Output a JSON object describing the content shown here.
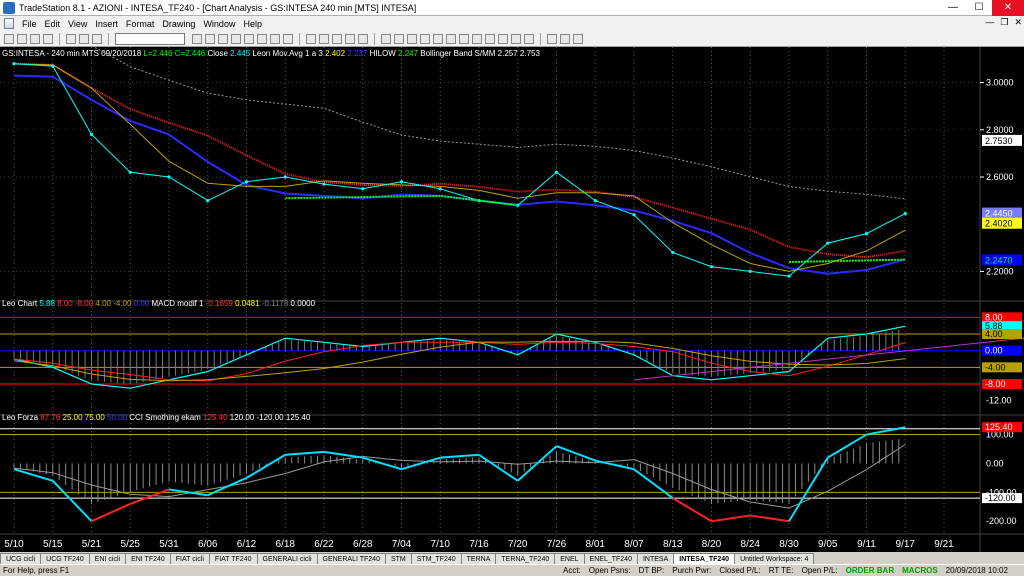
{
  "window": {
    "title": "TradeStation 8.1 - AZIONI - INTESA_TF240 - [Chart Analysis - GS:INTESA  240 min  [MTS] INTESA]"
  },
  "menu": [
    "File",
    "Edit",
    "View",
    "Insert",
    "Format",
    "Drawing",
    "Window",
    "Help"
  ],
  "chart": {
    "price_header": [
      {
        "text": "GS:INTESA - 240 min   MTS  09/20/2018  ",
        "color": "#ffffff"
      },
      {
        "text": "L=2.446  ",
        "color": "#00ff00"
      },
      {
        "text": "C=2.446  ",
        "color": "#00ff00"
      },
      {
        "text": "Close   ",
        "color": "#ffffff"
      },
      {
        "text": "2.445  ",
        "color": "#00ffff"
      },
      {
        "text": "Leon Mov.Avg 1 a 3   ",
        "color": "#ffffff"
      },
      {
        "text": "2.402  ",
        "color": "#ffff00"
      },
      {
        "text": "2.237  ",
        "color": "#3b3bff"
      },
      {
        "text": "HILOW   ",
        "color": "#ffffff"
      },
      {
        "text": "2.247  ",
        "color": "#00ff00"
      },
      {
        "text": "Bollinger Band S/MM   ",
        "color": "#ffffff"
      },
      {
        "text": "2.257  ",
        "color": "#ffffff"
      },
      {
        "text": "2.753",
        "color": "#ffffff"
      }
    ],
    "macd_header": [
      {
        "text": "Leo Chart   ",
        "color": "#ffffff"
      },
      {
        "text": "5.88  ",
        "color": "#00ffff"
      },
      {
        "text": "8.00  ",
        "color": "#ff3030"
      },
      {
        "text": "-8.00  ",
        "color": "#ff3030"
      },
      {
        "text": "4.00  ",
        "color": "#b8a000"
      },
      {
        "text": "-4.00  ",
        "color": "#b8a000"
      },
      {
        "text": "0.00   ",
        "color": "#3b3bff"
      },
      {
        "text": "MACD modif 1   ",
        "color": "#ffffff"
      },
      {
        "text": "-0.1659  ",
        "color": "#ff3030"
      },
      {
        "text": "0.0481  ",
        "color": "#ffff00"
      },
      {
        "text": "-0.1178  ",
        "color": "#808080"
      },
      {
        "text": "0.0000",
        "color": "#ffffff"
      }
    ],
    "cci_header": [
      {
        "text": "Leo Forza   ",
        "color": "#ffffff"
      },
      {
        "text": "87.76  ",
        "color": "#ff3030"
      },
      {
        "text": "25.00  ",
        "color": "#ffff00"
      },
      {
        "text": "75.00  ",
        "color": "#ffff00"
      },
      {
        "text": "50.00  ",
        "color": "#3b3bff"
      },
      {
        "text": "CCI Smothing ekam   ",
        "color": "#ffffff"
      },
      {
        "text": "125.40  ",
        "color": "#ff3030"
      },
      {
        "text": "120.00  ",
        "color": "#ffffff"
      },
      {
        "text": "-120.00  ",
        "color": "#ffffff"
      },
      {
        "text": "125.40",
        "color": "#ffffff"
      }
    ],
    "price_axis": [
      "3.0000",
      "2.8000",
      "2.6000",
      "2.2000"
    ],
    "price_markers": [
      {
        "text": "2.7530",
        "bg": "#ffffff",
        "fg": "#000000",
        "value": 2.753
      },
      {
        "text": "2.4450",
        "bg": "#7b7bff",
        "fg": "#ffffff",
        "value": 2.445
      },
      {
        "text": "2.4020",
        "bg": "#ffff00",
        "fg": "#000000",
        "value": 2.402
      },
      {
        "text": "2.2470",
        "bg": "#0000ff",
        "fg": "#00ff00",
        "value": 2.247
      }
    ],
    "macd_axis": [
      "8.00",
      "4.00",
      "0.00",
      "-4.00",
      "-8.00",
      "-12.00"
    ],
    "macd_markers": [
      {
        "text": "8.00",
        "bg": "#ff0000",
        "fg": "#ffffff",
        "value": 8
      },
      {
        "text": "5.88",
        "bg": "#00ffff",
        "fg": "#000000",
        "value": 5.88
      },
      {
        "text": "4.00",
        "bg": "#b8a000",
        "fg": "#000000",
        "value": 4
      },
      {
        "text": "0.00",
        "bg": "#0000ff",
        "fg": "#ffffff",
        "value": 0
      },
      {
        "text": "-4.00",
        "bg": "#b8a000",
        "fg": "#000000",
        "value": -4
      },
      {
        "text": "-8.00",
        "bg": "#ff0000",
        "fg": "#ffffff",
        "value": -8
      }
    ],
    "cci_axis": [
      "100.00",
      "0.00",
      "-100.00",
      "-200.00"
    ],
    "cci_markers": [
      {
        "text": "125.40",
        "bg": "#ff0000",
        "fg": "#ffffff",
        "value": 125.4
      },
      {
        "text": "-120.00",
        "bg": "#ffffff",
        "fg": "#000000",
        "value": -120
      }
    ],
    "date_labels": [
      "5/10",
      "5/15",
      "5/21",
      "5/25",
      "5/31",
      "6/06",
      "6/12",
      "6/18",
      "6/22",
      "6/28",
      "7/04",
      "7/10",
      "7/16",
      "7/20",
      "7/26",
      "8/01",
      "8/07",
      "8/13",
      "8/20",
      "8/24",
      "8/30",
      "9/05",
      "9/11",
      "9/17",
      "9/21"
    ]
  },
  "tabs": [
    "UCG cicli",
    "UCG TF240",
    "ENI cicli",
    "ENI TF240",
    "FIAT cicli",
    "FIAT TF240",
    "GENERALI cicli",
    "GENERALI TF240",
    "STM",
    "STM_TF240",
    "TERNA",
    "TERNA_TF240",
    "ENEL",
    "ENEL_TF240",
    "INTESA",
    "INTESA_TF240",
    "Untitled Workspace: 4"
  ],
  "active_tab": "INTESA_TF240",
  "status": {
    "help": "For Help, press F1",
    "acct": "Acct:",
    "open_psns": "Open Psns:",
    "dt_bp": "DT BP:",
    "purch_pwr": "Purch Pwr:",
    "closed_pl": "Closed P/L:",
    "rt_te": "RT TE:",
    "open_pl": "Open P/L:",
    "order_bar": "ORDER BAR",
    "macros": "MACROS",
    "clock": "20/09/2018 10:02"
  },
  "chart_data": {
    "type": "line",
    "x": [
      "5/10",
      "5/15",
      "5/21",
      "5/25",
      "5/31",
      "6/06",
      "6/12",
      "6/18",
      "6/22",
      "6/28",
      "7/04",
      "7/10",
      "7/16",
      "7/20",
      "7/26",
      "8/01",
      "8/07",
      "8/13",
      "8/20",
      "8/24",
      "8/30",
      "9/05",
      "9/11",
      "9/17"
    ],
    "ylim": [
      2.1,
      3.1
    ],
    "series": [
      {
        "name": "Close",
        "color": "#00ffff",
        "values": [
          3.08,
          3.07,
          2.78,
          2.62,
          2.6,
          2.5,
          2.58,
          2.6,
          2.57,
          2.55,
          2.58,
          2.55,
          2.5,
          2.48,
          2.62,
          2.5,
          2.44,
          2.28,
          2.22,
          2.2,
          2.18,
          2.32,
          2.36,
          2.445
        ]
      }
    ],
    "cci": [
      -20,
      -60,
      -200,
      -140,
      -90,
      -110,
      -50,
      30,
      40,
      20,
      -20,
      20,
      30,
      -60,
      60,
      10,
      -20,
      -120,
      -200,
      -180,
      -200,
      20,
      100,
      125.4
    ],
    "macd": [
      -2,
      -4,
      -8,
      -9,
      -7,
      -5,
      -1,
      3,
      2,
      1,
      2,
      3,
      2,
      -1,
      4,
      2,
      -1,
      -6,
      -7,
      -6,
      -5,
      3,
      4,
      5.88
    ]
  }
}
